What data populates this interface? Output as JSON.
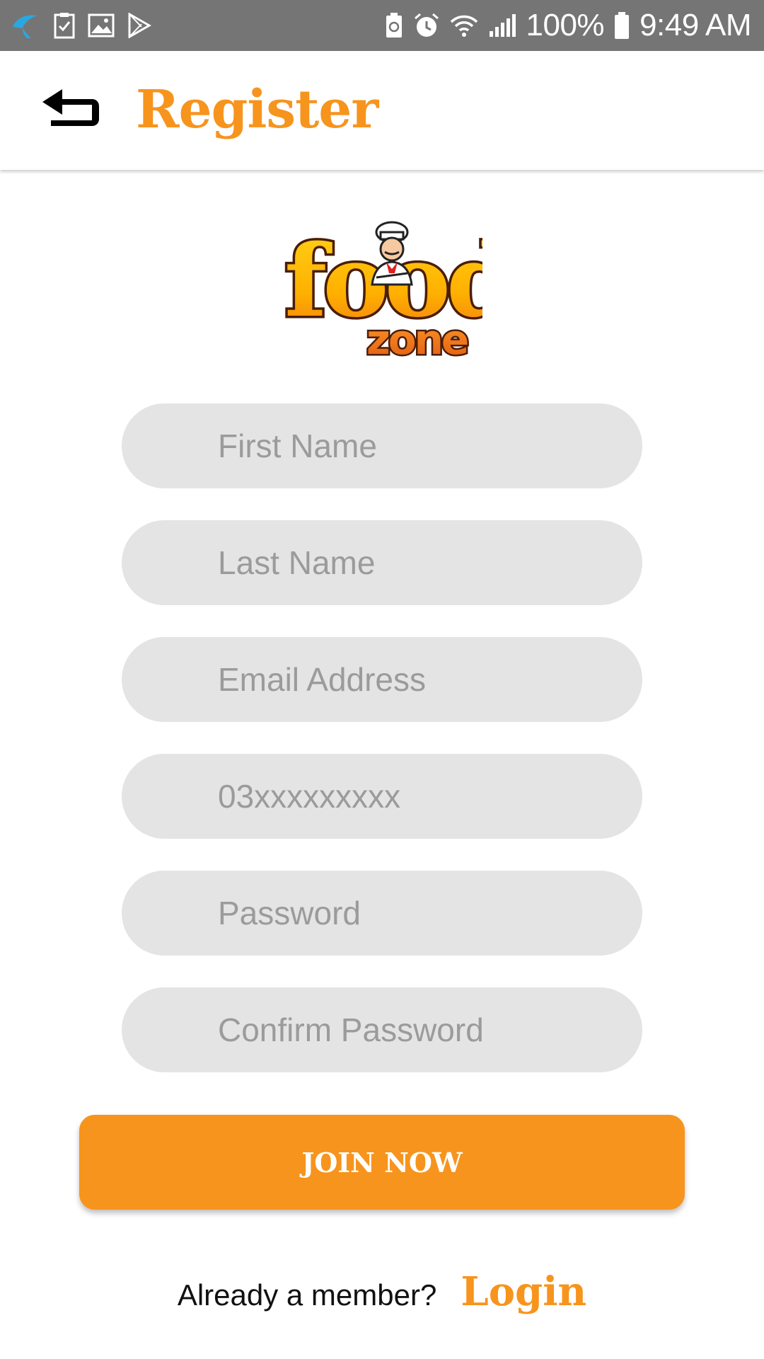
{
  "status_bar": {
    "battery": "100%",
    "time": "9:49 AM",
    "left_icons": [
      "telenor-icon",
      "task-icon",
      "gallery-icon",
      "play-store-icon"
    ],
    "right_icons": [
      "battery-saver-icon",
      "alarm-icon",
      "wifi-icon",
      "signal-icon",
      "battery-icon"
    ]
  },
  "app_bar": {
    "title": "Register",
    "back_icon": "back-arrow-icon"
  },
  "logo": {
    "text_main": "food",
    "text_sub": "zone"
  },
  "form": {
    "first_name_placeholder": "First Name",
    "last_name_placeholder": "Last Name",
    "email_placeholder": "Email Address",
    "phone_placeholder": "03xxxxxxxxx",
    "password_placeholder": "Password",
    "confirm_password_placeholder": "Confirm Password",
    "submit_label": "JOIN NOW"
  },
  "footer": {
    "prompt": "Already a member?",
    "login_label": "Login"
  },
  "colors": {
    "accent": "#f7941d",
    "status_bar": "#757575",
    "field_bg": "#e4e4e4",
    "placeholder": "#9b9b9b"
  }
}
